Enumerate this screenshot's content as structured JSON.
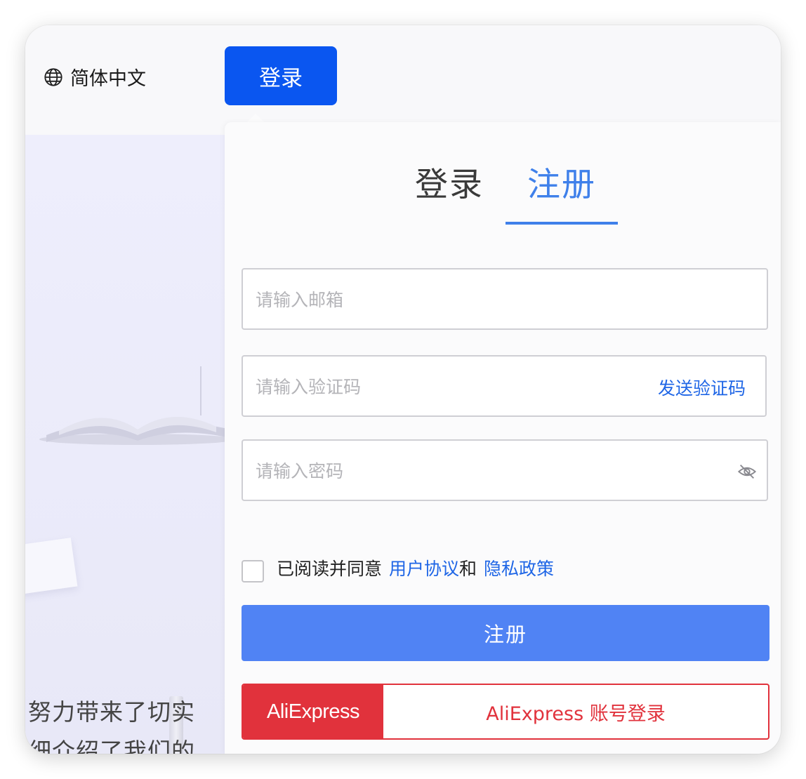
{
  "header": {
    "language_label": "简体中文",
    "language_icon": "globe-icon",
    "login_button": "登录"
  },
  "hero": {
    "line1": "努力带来了切实",
    "line2": "细介绍了我们的"
  },
  "auth_panel": {
    "tabs": [
      {
        "label": "登录",
        "active": false
      },
      {
        "label": "注册",
        "active": true
      }
    ],
    "email_placeholder": "请输入邮箱",
    "code_placeholder": "请输入验证码",
    "send_code_label": "发送验证码",
    "password_placeholder": "请输入密码",
    "password_visibility_icon": "eye-off-icon",
    "agreement": {
      "prefix": "已阅读并同意",
      "user_agreement": "用户协议",
      "and": "和",
      "privacy_policy": "隐私政策",
      "checked": false
    },
    "submit_label": "注册",
    "aliexpress": {
      "logo_text": "AliExpress",
      "label": "AliExpress 账号登录"
    }
  },
  "colors": {
    "primary_button": "#0a56f0",
    "tab_active": "#3f80ea",
    "link": "#1f66e6",
    "submit": "#5083f4",
    "aliexpress_red": "#e1323c"
  }
}
